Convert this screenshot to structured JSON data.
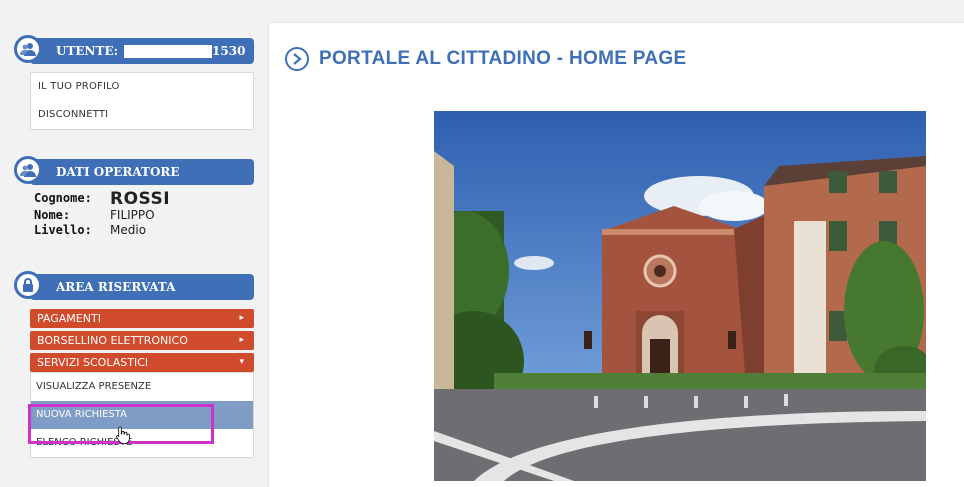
{
  "user_section": {
    "header_label": "UTENTE:",
    "user_suffix": "1530",
    "links": [
      "IL TUO PROFILO",
      "DISCONNETTI"
    ]
  },
  "operator_section": {
    "header_label": "DATI OPERATORE",
    "rows": [
      {
        "label": "Cognome:",
        "value": "ROSSI"
      },
      {
        "label": "Nome:",
        "value": "FILIPPO"
      },
      {
        "label": "Livello:",
        "value": "Medio"
      }
    ]
  },
  "reserved_section": {
    "header_label": "AREA RISERVATA",
    "menus": [
      {
        "label": "PAGAMENTI",
        "caret": "▸"
      },
      {
        "label": "BORSELLINO ELETTRONICO",
        "caret": "▸"
      },
      {
        "label": "SERVIZI SCOLASTICI",
        "caret": "▾"
      }
    ],
    "submenu": [
      "VISUALIZZA PRESENZE",
      "NUOVA RICHIESTA",
      "ELENCO RICHIESTE"
    ]
  },
  "main": {
    "title": "PORTALE AL CITTADINO - HOME PAGE"
  },
  "colors": {
    "accent_blue": "#3f6fb6",
    "menu_red": "#d04a2c",
    "highlight_magenta": "#cc33cc"
  }
}
